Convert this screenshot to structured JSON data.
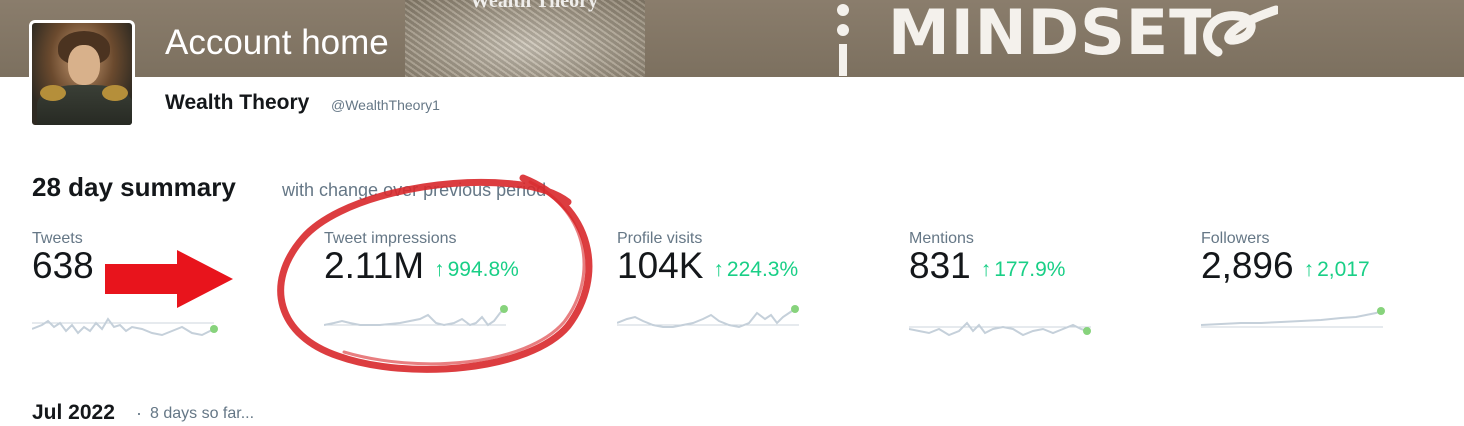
{
  "banner": {
    "overlay_text": "Wealth Theory",
    "brand_text": "MINDSET",
    "background_color": "#7c705f"
  },
  "header": {
    "title": "Account home",
    "account_name": "Wealth Theory",
    "account_handle": "@WealthTheory1"
  },
  "summary": {
    "title": "28 day summary",
    "subtitle": "with change over previous period",
    "stats": [
      {
        "label": "Tweets",
        "value": "638",
        "change": ""
      },
      {
        "label": "Tweet impressions",
        "value": "2.11M",
        "change": "994.8%"
      },
      {
        "label": "Profile visits",
        "value": "104K",
        "change": "224.3%"
      },
      {
        "label": "Mentions",
        "value": "831",
        "change": "177.9%"
      },
      {
        "label": "Followers",
        "value": "2,896",
        "change": "2,017"
      }
    ],
    "change_arrow": "↑",
    "change_color": "#19cf86"
  },
  "month": {
    "title": "Jul 2022",
    "separator": "·",
    "subtitle": "8 days so far..."
  },
  "annotations": {
    "arrow_color": "#e8141c",
    "circle_color": "#d8282b",
    "highlighted_stat": "Tweet impressions"
  }
}
